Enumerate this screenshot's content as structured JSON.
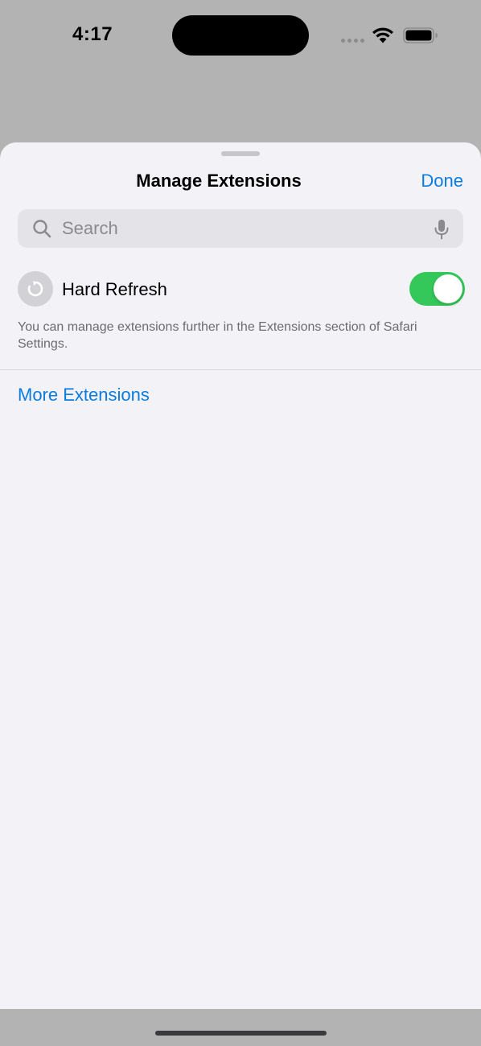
{
  "status_bar": {
    "time": "4:17"
  },
  "sheet": {
    "title": "Manage Extensions",
    "done_label": "Done",
    "search": {
      "placeholder": "Search",
      "value": ""
    },
    "extensions": [
      {
        "name": "Hard Refresh",
        "icon": "refresh-icon",
        "enabled": true
      }
    ],
    "footnote": "You can manage extensions further in the Extensions section of Safari Settings.",
    "more_extensions_label": "More Extensions"
  },
  "colors": {
    "accent": "#0a7ce0",
    "toggle_on": "#34c759",
    "sheet_background": "#f2f2f7",
    "dimmed_background": "#b3b3b3"
  }
}
